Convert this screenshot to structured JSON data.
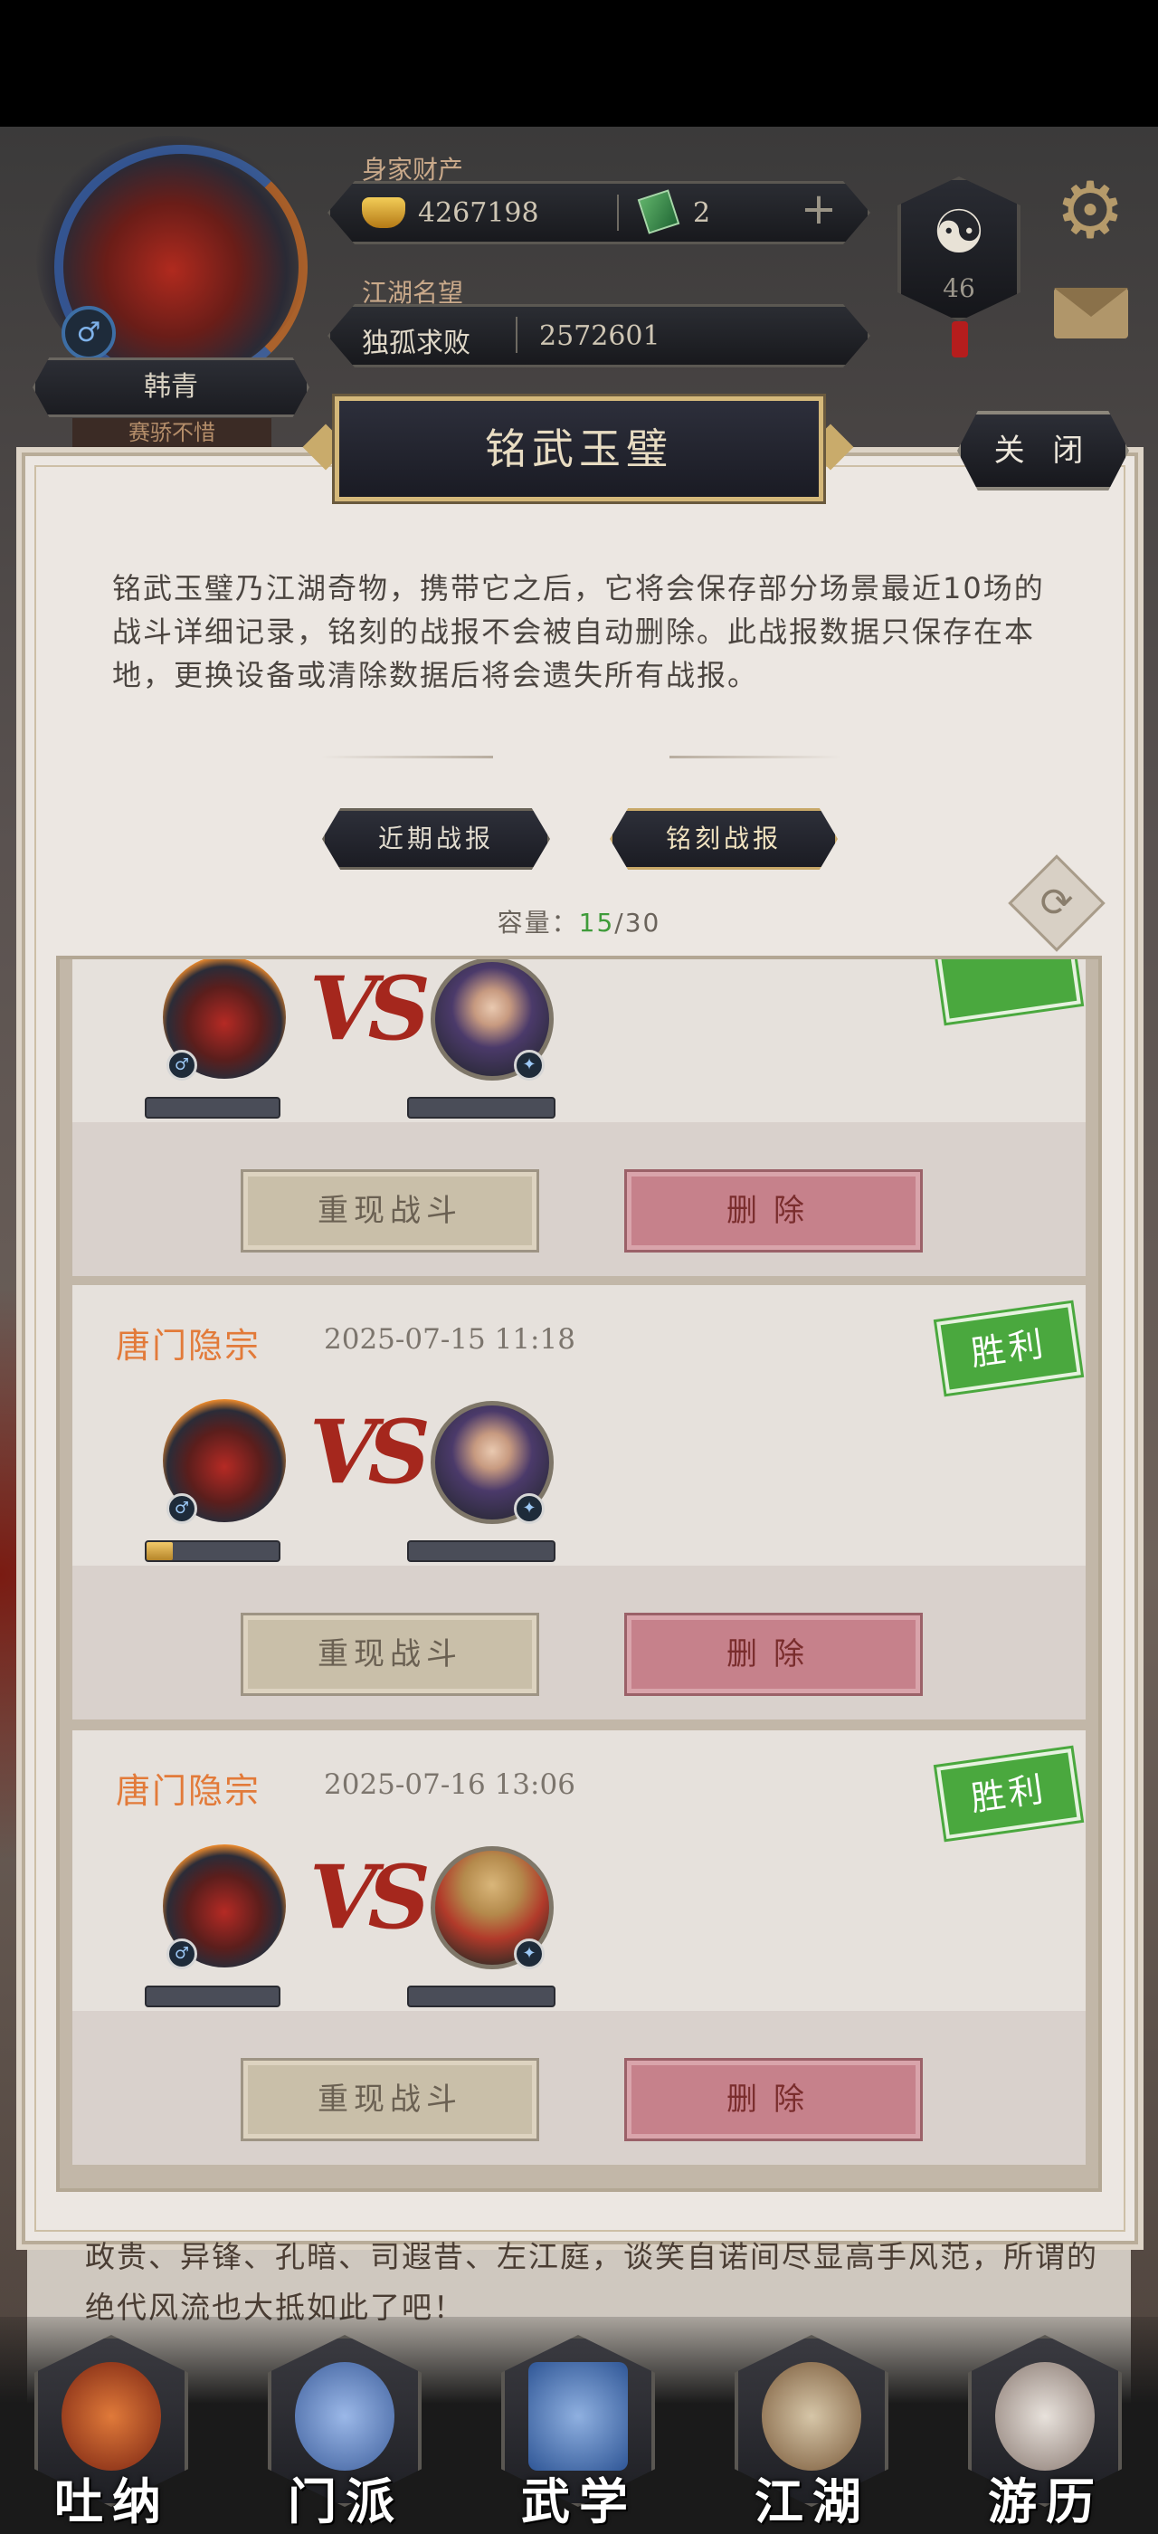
{
  "header": {
    "player_name": "韩青",
    "player_title": "赛骄不惜",
    "wealth_label": "身家财产",
    "gold": "4267198",
    "jade": "2",
    "fame_label": "江湖名望",
    "fame_rank": "独孤求败",
    "fame_value": "2572601",
    "level": "46",
    "icons": [
      "gear-icon",
      "mail-icon",
      "yinyang-icon",
      "gold-ingot-icon",
      "jade-icon",
      "plus-icon",
      "male-icon"
    ]
  },
  "modal": {
    "title": "铭武玉璧",
    "close_label": "关 闭",
    "description": "铭武玉璧乃江湖奇物，携带它之后，它将会保存部分场景最近10场的战斗详细记录，铭刻的战报不会被自动删除。此战报数据只保存在本地，更换设备或清除数据后将会遗失所有战报。",
    "tabs": [
      {
        "label": "近期战报",
        "active": false
      },
      {
        "label": "铭刻战报",
        "active": true
      }
    ],
    "capacity_label": "容量：",
    "capacity_used": "15",
    "capacity_total": "/30"
  },
  "battles": [
    {
      "sect": "",
      "date": "",
      "result": "",
      "opponent_type": "lady",
      "my_hp_fraction": 0,
      "replay_label": "重现战斗",
      "delete_label": "删除"
    },
    {
      "sect": "唐门隐宗",
      "date": "2025-07-15 11:18",
      "result": "胜利",
      "opponent_type": "lady",
      "my_hp_fraction": 0.2,
      "replay_label": "重现战斗",
      "delete_label": "删除"
    },
    {
      "sect": "唐门隐宗",
      "date": "2025-07-16 13:06",
      "result": "胜利",
      "opponent_type": "monk",
      "my_hp_fraction": 0,
      "replay_label": "重现战斗",
      "delete_label": "删除"
    }
  ],
  "footer_story": "政贵、异锋、孔暗、司遐昔、左江庭，谈笑自诺间尽显高手风范，所谓的绝代风流也大抵如此了吧！",
  "nav": [
    {
      "label": "吐纳",
      "color": "#c0502a"
    },
    {
      "label": "门派",
      "color": "#4f78c4"
    },
    {
      "label": "武学",
      "color": "#3f70b8"
    },
    {
      "label": "江湖",
      "color": "#8a5a3a"
    },
    {
      "label": "游历",
      "color": "#a99a92"
    }
  ],
  "colors": {
    "accent_orange": "#e27a39",
    "win_green": "#4aa83e",
    "delete_red": "#c6818b",
    "gold_border": "#d4b87a"
  }
}
